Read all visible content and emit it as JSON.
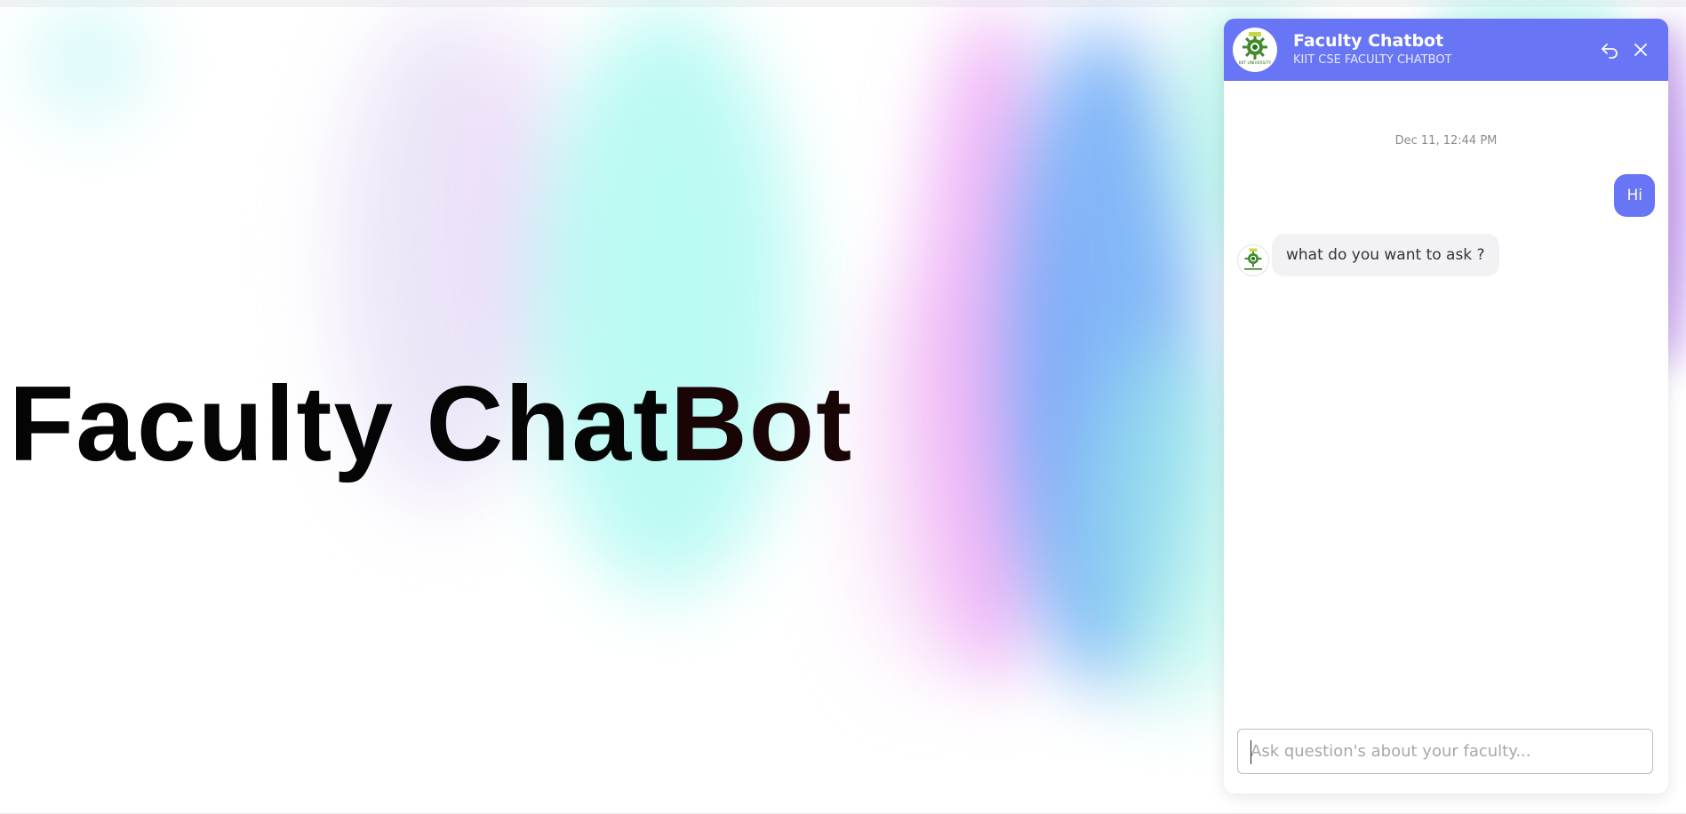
{
  "hero": {
    "title_part1": "Faculty Chat",
    "title_part2": "Bot"
  },
  "chat": {
    "header": {
      "title": "Faculty Chatbot",
      "subtitle": "KIIT CSE FACULTY CHATBOT",
      "avatar_icon": "kiit-university-logo",
      "avatar_text": "KIIT UNIVERSITY",
      "back_icon": "reply-arrow-icon",
      "close_icon": "close-icon"
    },
    "timestamp": "Dec 11, 12:44 PM",
    "messages": [
      {
        "sender": "user",
        "text": "Hi"
      },
      {
        "sender": "bot",
        "text": "what do you want to ask ?"
      }
    ],
    "input": {
      "placeholder": "Ask question's about your faculty...",
      "value": ""
    }
  },
  "colors": {
    "accent": "#6875f5",
    "bot_bubble": "#f2f2f4",
    "hero_text": "#050505"
  }
}
